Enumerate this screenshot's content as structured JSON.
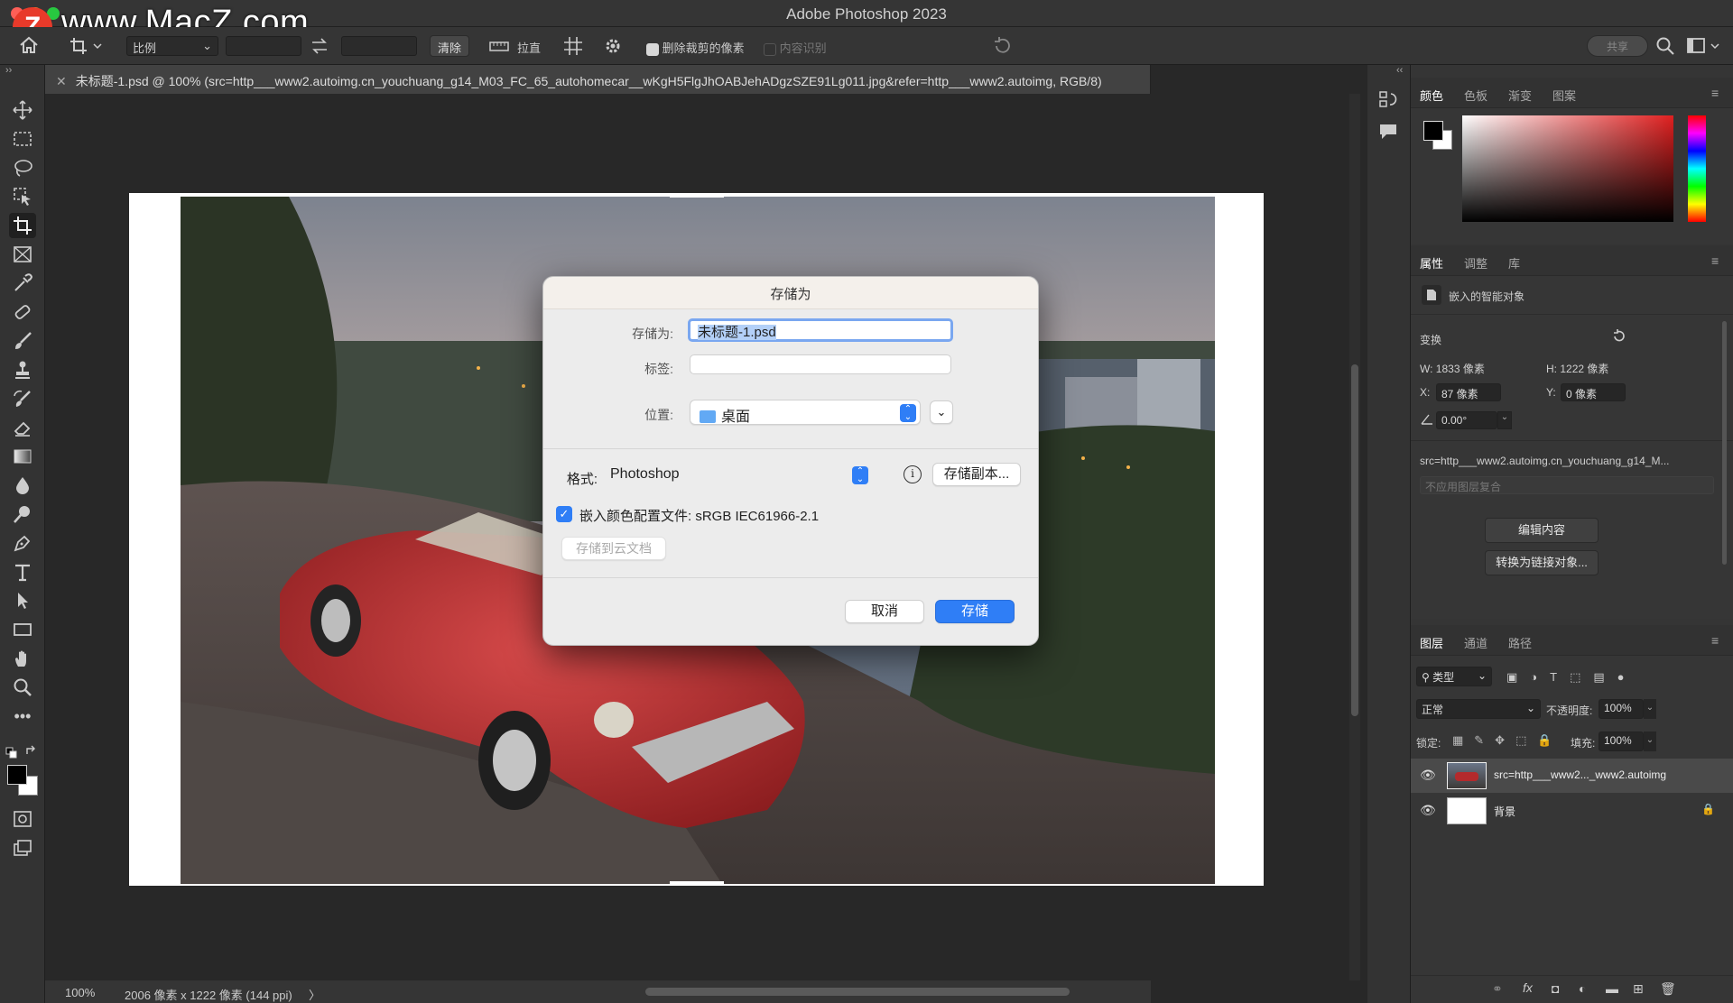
{
  "window": {
    "title": "Adobe Photoshop 2023",
    "watermark": "www.MacZ.com",
    "watermark_logo": "Z"
  },
  "options_bar": {
    "ratio_label": "比例",
    "clear_label": "清除",
    "straighten_label": "拉直",
    "delete_cropped_label": "删除裁剪的像素",
    "content_aware_label": "内容识别",
    "share_label": "共享"
  },
  "document": {
    "tab_title": "未标题-1.psd @ 100% (src=http___www2.autoimg.cn_youchuang_g14_M03_FC_65_autohomecar__wKgH5FlgJhOABJehADgzSZE91Lg011.jpg&refer=http___www2.autoimg, RGB/8)"
  },
  "status_bar": {
    "zoom": "100%",
    "doc_info": "2006 像素 x 1222 像素 (144 ppi)",
    "arrow": "〉"
  },
  "save_dialog": {
    "title": "存储为",
    "save_as_label": "存储为:",
    "filename": "未标题-1.psd",
    "tags_label": "标签:",
    "tags_value": "",
    "location_label": "位置:",
    "location_value": "桌面",
    "format_label": "格式:",
    "format_value": "Photoshop",
    "save_copy_label": "存储副本...",
    "embed_profile_label": "嵌入颜色配置文件: sRGB IEC61966-2.1",
    "embed_profile_checked": true,
    "cloud_label": "存储到云文档",
    "cancel_label": "取消",
    "save_label": "存储"
  },
  "color_panel": {
    "tabs": [
      "颜色",
      "色板",
      "渐变",
      "图案"
    ],
    "foreground": "#000000",
    "background": "#ffffff",
    "hue_color": "#e02020"
  },
  "properties_panel": {
    "tabs": [
      "属性",
      "调整",
      "库"
    ],
    "object_type": "嵌入的智能对象",
    "transform_label": "变换",
    "w_label": "W:",
    "w_value": "1833 像素",
    "h_label": "H:",
    "h_value": "1222 像素",
    "x_label": "X:",
    "x_value": "87 像素",
    "y_label": "Y:",
    "y_value": "0 像素",
    "angle_value": "0.00°",
    "source_name": "src=http___www2.autoimg.cn_youchuang_g14_M...",
    "layer_comp_placeholder": "不应用图层复合",
    "edit_contents_label": "编辑内容",
    "convert_linked_label": "转换为链接对象..."
  },
  "layers_panel": {
    "tabs": [
      "图层",
      "通道",
      "路径"
    ],
    "filter_label": "类型",
    "blend_mode": "正常",
    "opacity_label": "不透明度:",
    "opacity_value": "100%",
    "lock_label": "锁定:",
    "fill_label": "填充:",
    "fill_value": "100%",
    "layers": [
      {
        "name": "src=http___www2..._www2.autoimg",
        "visible": true,
        "locked": false
      },
      {
        "name": "背景",
        "visible": true,
        "locked": true
      }
    ]
  },
  "colors": {
    "accent": "#2f7ef6",
    "ui_bg": "#353535"
  }
}
